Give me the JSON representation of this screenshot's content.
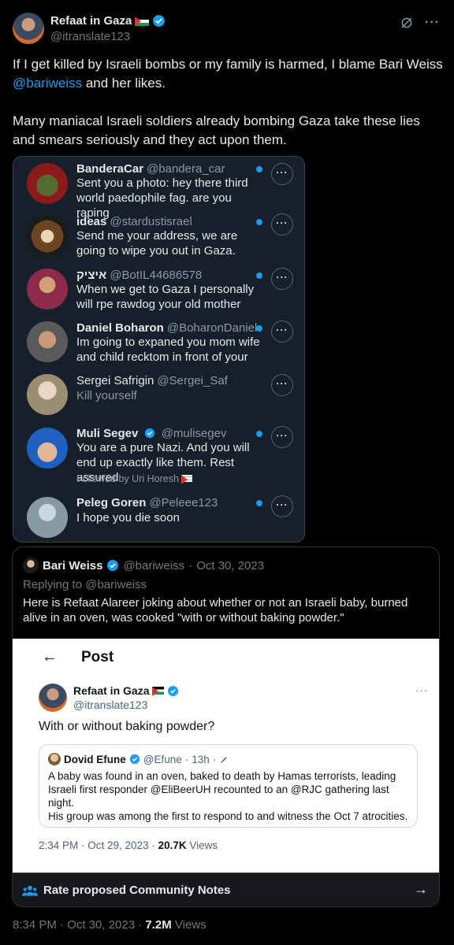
{
  "author": {
    "name": "Refaat in Gaza",
    "handle": "@itranslate123",
    "icons": [
      "palestine-flag-icon",
      "verified-badge-icon",
      "grok-icon",
      "more-icon"
    ]
  },
  "tweet": {
    "line1_pre": "If I get killed by Israeli bombs or my family is harmed, I blame Bari Weiss",
    "line1_mention": "@bariweiss",
    "line1_post": " and her likes.",
    "line2": "Many maniacal Israeli soldiers already bombing Gaza take these lies and smears seriously and they act upon them."
  },
  "dm_list": [
    {
      "name": "BanderaCar",
      "handle": "@bandera_car",
      "message": "Sent you a photo: hey there third world paedophile fag. are you raping",
      "unread": true,
      "bold": true,
      "followed": ""
    },
    {
      "name": "ideas",
      "handle": "@stardustisrael",
      "message": "Send me your address, we are going to wipe you out in Gaza.",
      "unread": true,
      "bold": true,
      "followed": ""
    },
    {
      "name": "איציק",
      "handle": "@BotIL44686578",
      "message": "When we get to Gaza I personally will rpe rawdog your old mother",
      "unread": true,
      "bold": true,
      "followed": ""
    },
    {
      "name": "Daniel Boharon",
      "handle": "@BoharonDaniel",
      "message": "Im going to expaned you mom wife and child recktom in front of your",
      "unread": true,
      "bold": true,
      "followed": ""
    },
    {
      "name": "Sergei Safrigin",
      "handle": "@Sergei_Saf",
      "message": "Kill yourself",
      "unread": false,
      "bold": false,
      "followed": ""
    },
    {
      "name": "Muli Segev",
      "handle": "@mulisegev",
      "message": "You are a pure Nazi. And you will end up exactly like them. Rest assured",
      "unread": true,
      "bold": true,
      "followed": "Followed by Uri Horesh"
    },
    {
      "name": "Peleg Goren",
      "handle": "@Peleee123",
      "message": "I hope you die soon",
      "unread": true,
      "bold": true,
      "followed": ""
    }
  ],
  "quote": {
    "name": "Bari Weiss",
    "handle": "@bariweiss",
    "date": "Oct 30, 2023",
    "replying_to": "Replying to @bariweiss",
    "text": "Here is Refaat Alareer joking about whether or not an Israeli baby, burned alive in an oven, was cooked \"with or without baking powder.\""
  },
  "screenshot": {
    "header_title": "Post",
    "author_name": "Refaat in Gaza",
    "author_handle": "@itranslate123",
    "text": "With or without baking powder?",
    "inner_quote": {
      "name": "Dovid Efune",
      "handle": "@Efune",
      "age": "13h",
      "text1": "A baby was found in an oven, baked to death by Hamas terrorists, leading Israeli first responder @EliBeerUH recounted to an @RJC gathering last night.",
      "text2": "His group was among the first to respond to and witness the Oct 7 atrocities."
    },
    "time": "2:34 PM · Oct 29, 2023 · ",
    "views_count": "20.7K",
    "views_label": " Views"
  },
  "community_notes": {
    "label": "Rate proposed Community Notes"
  },
  "footer": {
    "time": "8:34 PM · Oct 30, 2023 · ",
    "views_count": "7.2M",
    "views_label": " Views"
  }
}
